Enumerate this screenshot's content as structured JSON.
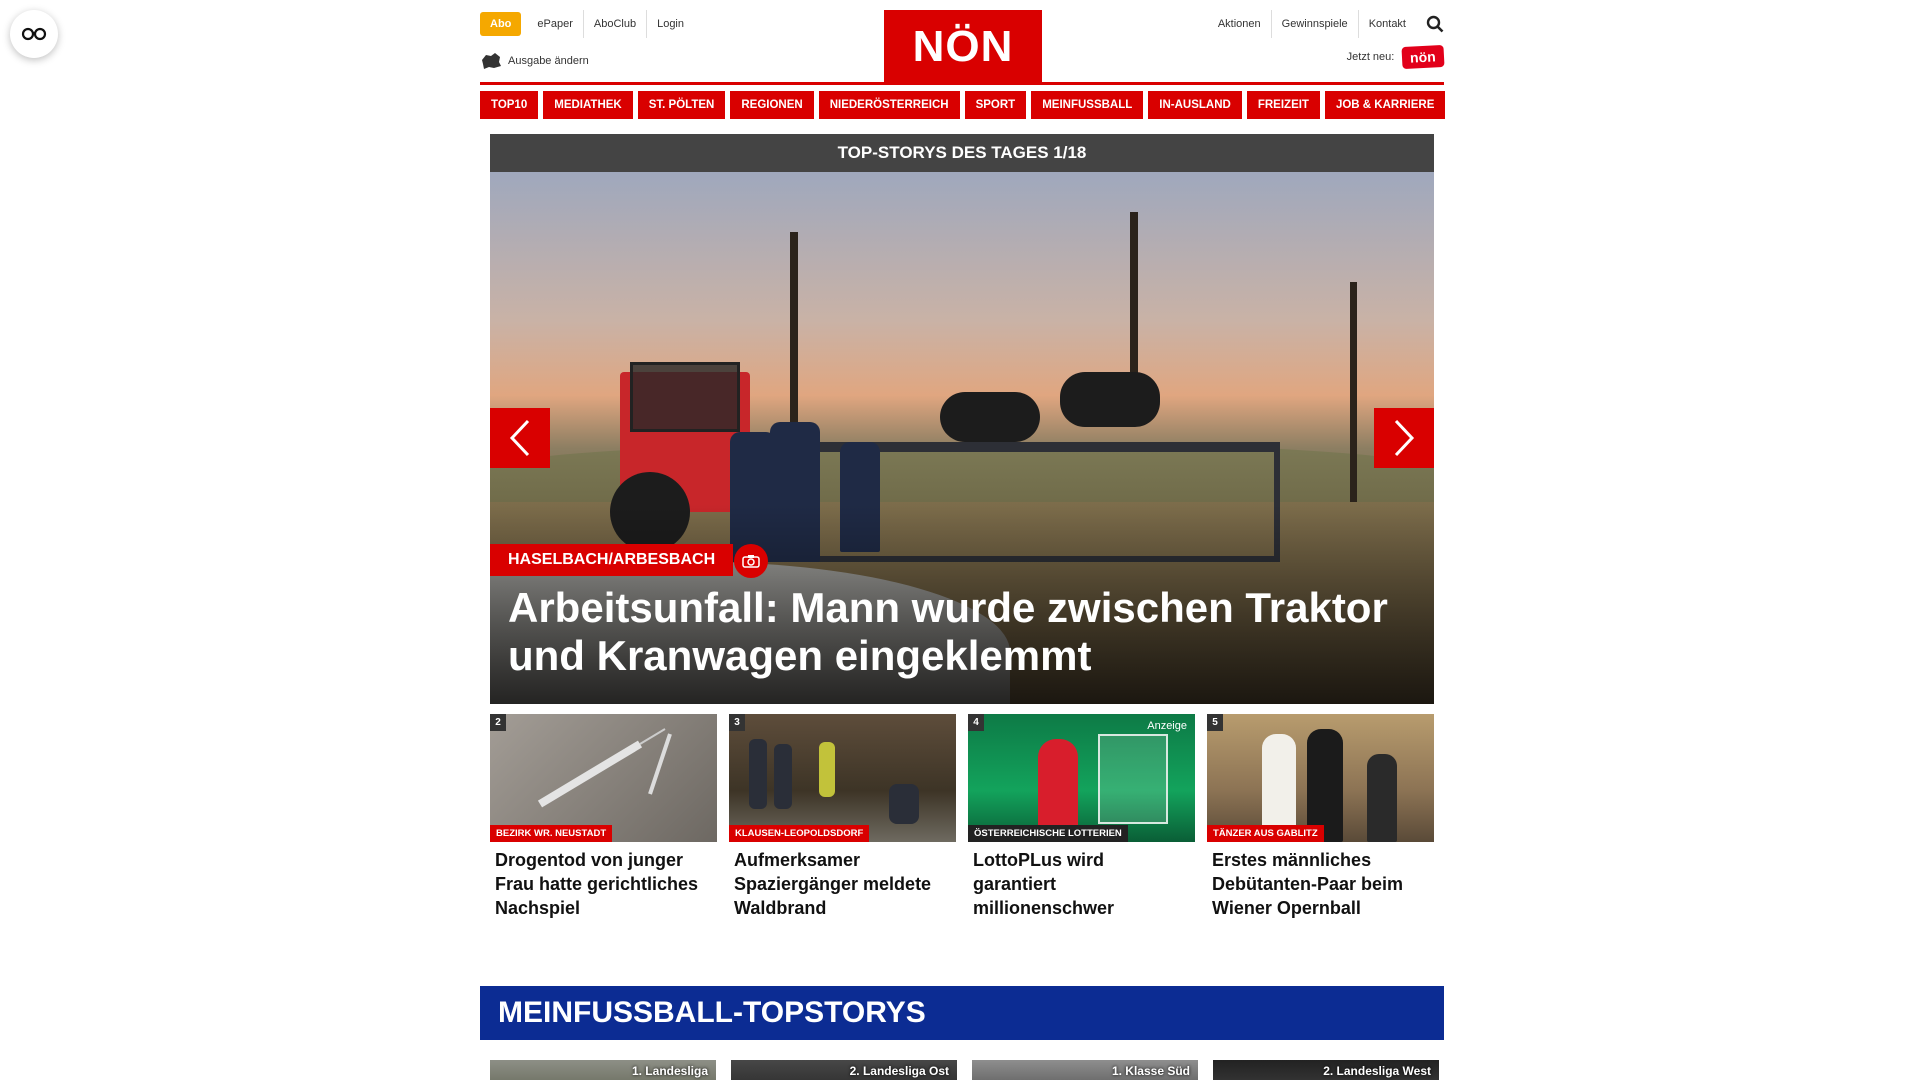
{
  "header": {
    "abo_label": "Abo",
    "left_links": [
      "ePaper",
      "AboClub",
      "Login"
    ],
    "ausgabe_label": "Ausgabe ändern",
    "logo_text": "NÖN",
    "right_links": [
      "Aktionen",
      "Gewinnspiele",
      "Kontakt"
    ],
    "jetzt_label": "Jetzt neu:",
    "badge_text": "nön"
  },
  "nav": [
    "TOP10",
    "MEDIATHEK",
    "ST. PÖLTEN",
    "REGIONEN",
    "NIEDERÖSTERREICH",
    "SPORT",
    "MEINFUSSBALL",
    "IN-AUSLAND",
    "FREIZEIT",
    "JOB & KARRIERE"
  ],
  "hero": {
    "heading": "TOP-STORYS DES TAGES 1/18",
    "tag": "HASELBACH/ARBESBACH",
    "title": "Arbeitsunfall: Mann wurde zwischen Traktor und Kranwagen eingeklemmt"
  },
  "cards": [
    {
      "num": "2",
      "tag": "BEZIRK WR. NEUSTADT",
      "title": "Drogentod von junger Frau hatte gerichtliches Nachspiel"
    },
    {
      "num": "3",
      "tag": "KLAUSEN-LEOPOLDSDORF",
      "title": "Aufmerksamer Spaziergänger meldete Waldbrand"
    },
    {
      "num": "4",
      "tag": "ÖSTERREICHISCHE LOTTERIEN",
      "anzeige": "Anzeige",
      "title": "LottoPLus wird garantiert millionenschwer"
    },
    {
      "num": "5",
      "tag": "TÄNZER AUS GABLITZ",
      "title": "Erstes männliches Debütanten-Paar beim Wiener Opernball"
    }
  ],
  "section": {
    "title": "MEINFUSSBALL-TOPSTORYS",
    "items": [
      "1. Landesliga",
      "2. Landesliga Ost",
      "1. Klasse Süd",
      "2. Landesliga West"
    ]
  },
  "colors": {
    "brand_red": "#d90000",
    "abo_orange": "#f5a800",
    "section_blue": "#0c2c93"
  }
}
